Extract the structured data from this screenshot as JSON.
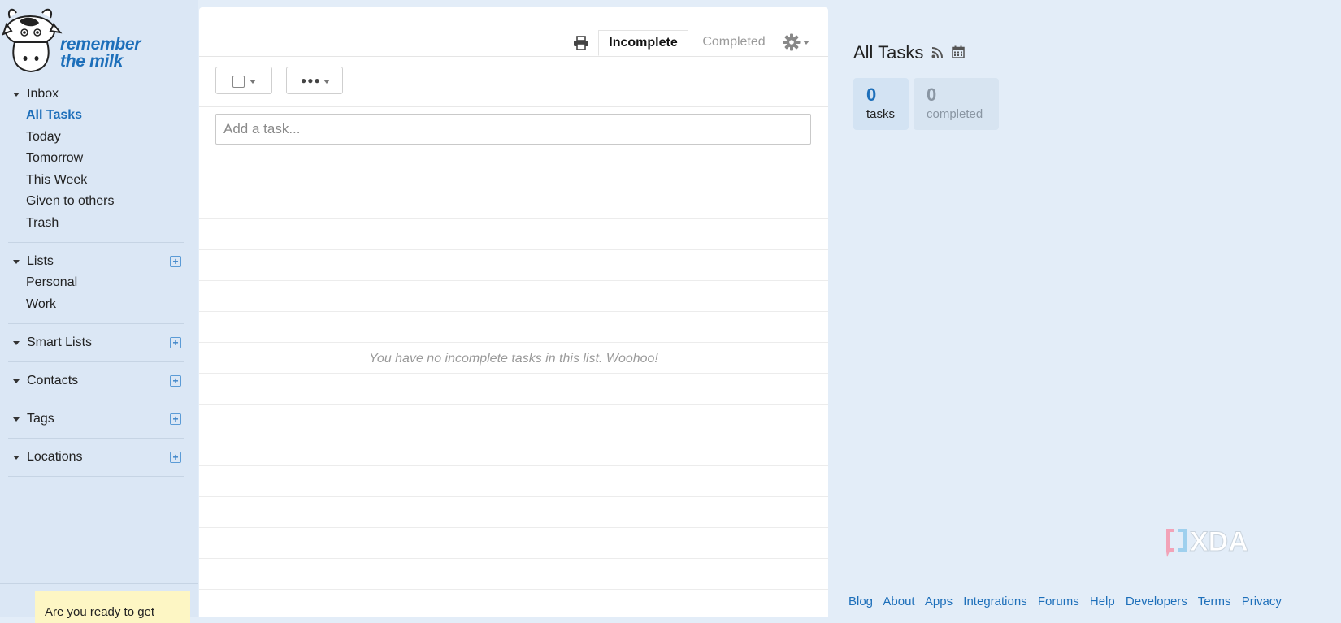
{
  "app": {
    "logo_text_line1": "remember",
    "logo_text_line2": "the milk",
    "brand_color": "#1d6fba"
  },
  "sidebar": {
    "inbox": {
      "title": "Inbox",
      "items": [
        "All Tasks",
        "Today",
        "Tomorrow",
        "This Week",
        "Given to others",
        "Trash"
      ],
      "active": "All Tasks"
    },
    "lists": {
      "title": "Lists",
      "items": [
        "Personal",
        "Work"
      ]
    },
    "smart_lists": {
      "title": "Smart Lists"
    },
    "contacts": {
      "title": "Contacts"
    },
    "tags": {
      "title": "Tags"
    },
    "locations": {
      "title": "Locations"
    },
    "promo_text": "Are you ready to get"
  },
  "main": {
    "tabs": {
      "incomplete": "Incomplete",
      "completed": "Completed"
    },
    "add_task_placeholder": "Add a task...",
    "empty_message": "You have no incomplete tasks in this list. Woohoo!",
    "icons": [
      "print-icon",
      "gear-icon",
      "checkbox-icon",
      "more-dots-icon"
    ]
  },
  "right": {
    "title": "All Tasks",
    "stats": {
      "tasks_count": "0",
      "tasks_label": "tasks",
      "completed_count": "0",
      "completed_label": "completed"
    },
    "watermark": "XDA",
    "footer_links": [
      "Blog",
      "About",
      "Apps",
      "Integrations",
      "Forums",
      "Help",
      "Developers",
      "Terms",
      "Privacy"
    ]
  }
}
